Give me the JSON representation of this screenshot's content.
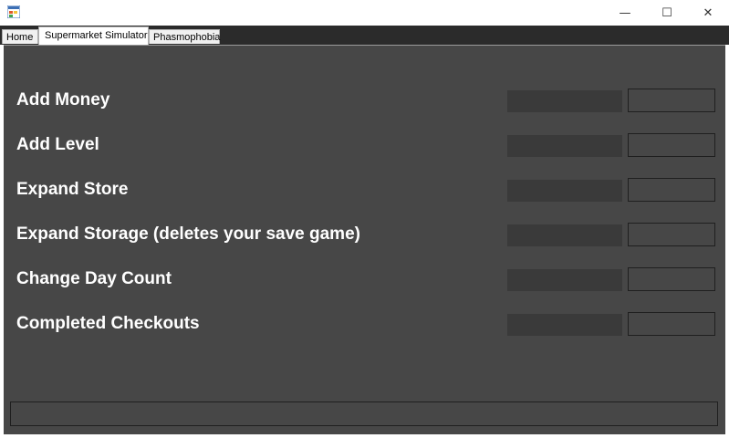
{
  "window": {
    "title": "",
    "controls": {
      "minimize_glyph": "—",
      "maximize_glyph": "☐",
      "close_glyph": "✕"
    }
  },
  "tabs": [
    {
      "label": "Home",
      "selected": false
    },
    {
      "label": "Supermarket Simulator",
      "selected": true
    },
    {
      "label": "Phasmophobia",
      "selected": false
    }
  ],
  "rows": [
    {
      "label": "Add Money",
      "input_value": "",
      "button_label": ""
    },
    {
      "label": "Add Level",
      "input_value": "",
      "button_label": ""
    },
    {
      "label": "Expand Store",
      "input_value": "",
      "button_label": ""
    },
    {
      "label": "Expand Storage (deletes your save game)",
      "input_value": "",
      "button_label": ""
    },
    {
      "label": "Change Day Count",
      "input_value": "",
      "button_label": ""
    },
    {
      "label": "Completed Checkouts",
      "input_value": "",
      "button_label": ""
    }
  ],
  "status": {
    "text": ""
  },
  "colors": {
    "panel_bg": "#474747",
    "input_bg": "#3a3a3a",
    "tabstrip_bg": "#2b2b2b",
    "label_text": "#ffffff"
  }
}
